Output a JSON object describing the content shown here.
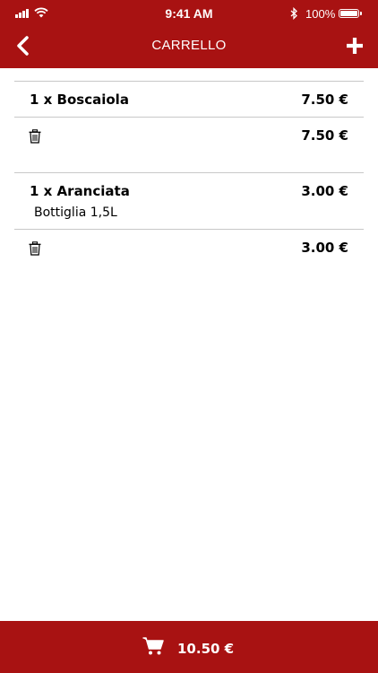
{
  "status_bar": {
    "time": "9:41 AM",
    "battery": "100%",
    "icons": [
      "signal-icon",
      "wifi-icon",
      "bluetooth-icon",
      "battery-icon"
    ]
  },
  "header": {
    "title": "CARRELLO",
    "left_icon": "chevron-left-icon",
    "right_icon": "plus-icon"
  },
  "cart": {
    "items": [
      {
        "name": "1 x Boscaiola",
        "description": "",
        "price": "7.50 €",
        "subtotal": "7.50 €"
      },
      {
        "name": "1 x Aranciata",
        "description": "Bottiglia 1,5L",
        "price": "3.00 €",
        "subtotal": "3.00 €"
      }
    ]
  },
  "bottom_bar": {
    "icon": "cart-icon",
    "total": "10.50 €"
  },
  "colors": {
    "brand": "#a81212",
    "divider": "#c8c8c8"
  }
}
